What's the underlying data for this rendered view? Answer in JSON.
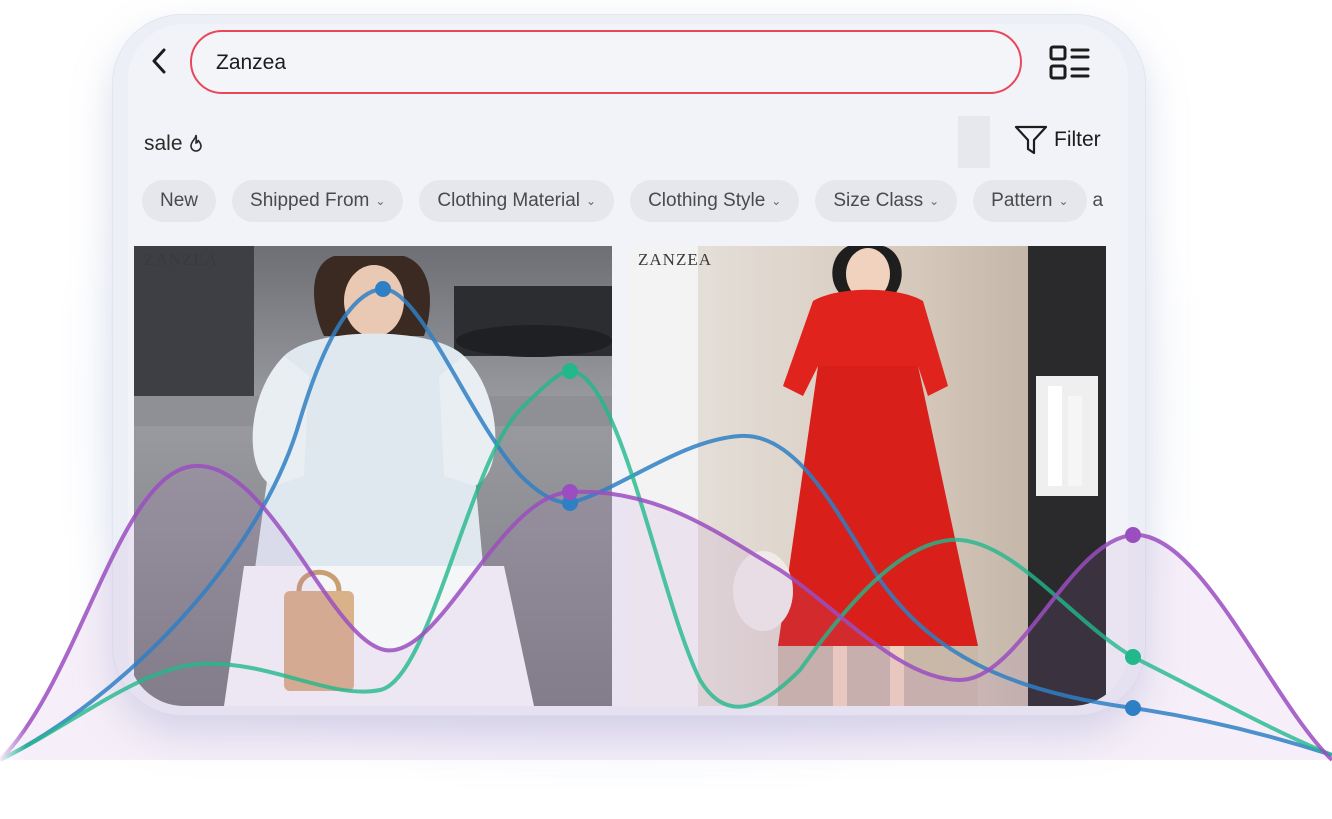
{
  "header": {
    "back_icon": "chevron-left-icon",
    "search_value": "Zanzea",
    "layout_icon": "grid-list-toggle-icon"
  },
  "promo": {
    "label": "sale",
    "icon": "flame-icon"
  },
  "filter": {
    "label": "Filter",
    "icon": "funnel-icon"
  },
  "chips": [
    {
      "label": "New",
      "dropdown": false
    },
    {
      "label": "Shipped From",
      "dropdown": true
    },
    {
      "label": "Clothing Material",
      "dropdown": true
    },
    {
      "label": "Clothing Style",
      "dropdown": true
    },
    {
      "label": "Size Class",
      "dropdown": true
    },
    {
      "label": "Pattern",
      "dropdown": true
    }
  ],
  "chip_overflow_text": "a",
  "products": [
    {
      "brand": "ZANZEA",
      "dress_color": "#f2f4f8"
    },
    {
      "brand": "ZANZEA",
      "dress_color": "#e0231c"
    }
  ],
  "colors": {
    "accent_border": "#e8475a",
    "line_blue": "#2f7fc4",
    "line_green": "#22b88c",
    "line_purple": "#9a4ec0"
  }
}
